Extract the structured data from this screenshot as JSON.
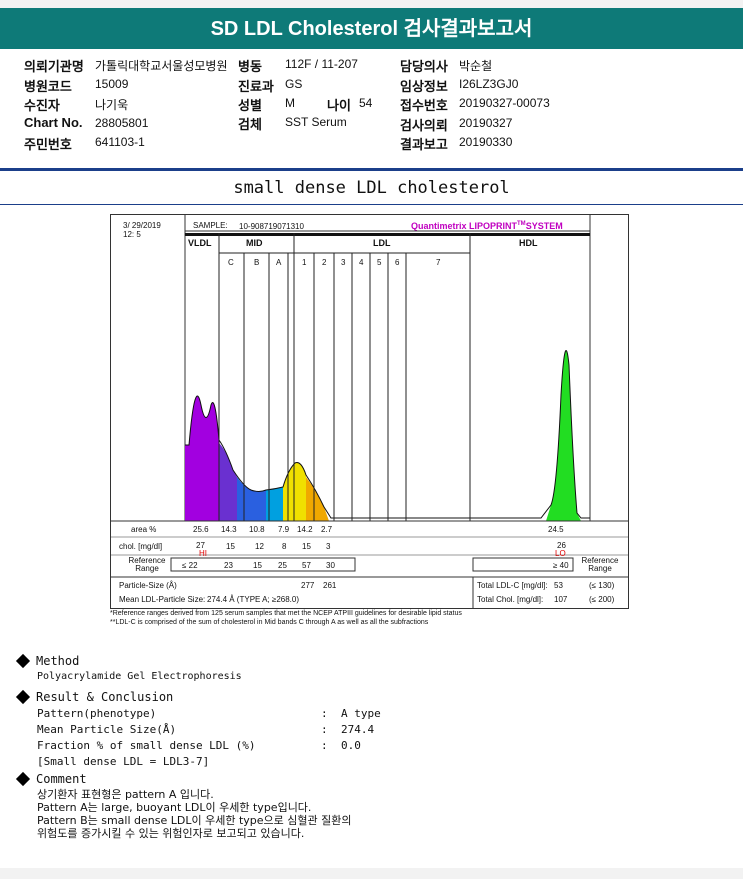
{
  "title": "SD LDL Cholesterol 검사결과보고서",
  "patient": {
    "hospital_label": "의뢰기관명",
    "hospital_value": "가톨릭대학교서울성모병원",
    "ward_label": "병동",
    "ward_value": "112F / 11-207",
    "doctor_label": "담당의사",
    "doctor_value": "박순철",
    "hcode_label": "병원코드",
    "hcode_value": "15009",
    "dept_label": "진료과",
    "dept_value": "GS",
    "clinical_label": "임상정보",
    "clinical_value": "I26LZ3GJ0",
    "name_label": "수진자",
    "name_value": "나기욱",
    "sex_label": "성별",
    "sex_value": "M",
    "age_label": "나이",
    "age_value": "54",
    "reg_label": "접수번호",
    "reg_value": "20190327-00073",
    "chart_label": "Chart No.",
    "chart_value": "28805801",
    "spec_label": "검체",
    "spec_value": "SST Serum",
    "req_label": "검사의뢰",
    "req_value": "20190327",
    "rrn_label": "주민번호",
    "rrn_value": "641103-1",
    "rep_label": "결과보고",
    "rep_value": "20190330"
  },
  "subtitle": "small dense LDL cholesterol",
  "chart": {
    "date": "3/ 29/2019",
    "time": "12: 5",
    "sample_label": "SAMPLE:",
    "sample_value": "10-908719071310",
    "brand": "Quantimetrix LIPOPRINT",
    "brand_tm": "TM",
    "brand_suffix": "SYSTEM",
    "group_vldl": "VLDL",
    "group_mid": "MID",
    "group_ldl": "LDL",
    "group_hdl": "HDL",
    "bands": [
      "C",
      "B",
      "A",
      "1",
      "2",
      "3",
      "4",
      "5",
      "6",
      "7"
    ],
    "row_area_label": "area %",
    "row_chol_label": "chol. [mg/dl]",
    "row_ref_label": "Reference Range",
    "ref_range_right": "Reference Range",
    "area_values": [
      "25.6",
      "14.3",
      "10.8",
      "7.9",
      "14.2",
      "2.7"
    ],
    "area_hdl": "24.5",
    "chol_values": [
      "27",
      "15",
      "12",
      "8",
      "15",
      "3"
    ],
    "chol_hdl": "26",
    "flag_hi": "HI",
    "flag_lo": "LO",
    "ref_values": [
      "≤ 22",
      "23",
      "15",
      "25",
      "57",
      "30"
    ],
    "ref_hdl": "≥ 40",
    "particle_label": "Particle-Size (Å)",
    "particle_values": [
      "277",
      "261"
    ],
    "mean_label": "Mean LDL-Particle Size:",
    "mean_value": "274.4 Å  (TYPE A; ≥268.0)",
    "total_ldl_label": "Total LDL-C [mg/dl]:",
    "total_ldl_value": "53",
    "total_ldl_ref": "(≤ 130)",
    "total_chol_label": "Total Chol. [mg/dl]:",
    "total_chol_value": "107",
    "total_chol_ref": "(≤ 200)"
  },
  "chart_data": {
    "type": "area",
    "x": [
      0,
      20,
      40,
      60,
      80,
      100
    ],
    "series": []
  },
  "notes": [
    "*Reference ranges derived from 125 serum samples that met the NCEP ATPIII guidelines for desirable lipid status",
    "**LDL-C is comprised of the sum of cholesterol in Mid bands C through A as well as all the subfractions"
  ],
  "method": {
    "heading": "Method",
    "text": "Polyacrylamide Gel Electrophoresis"
  },
  "result": {
    "heading": "Result & Conclusion",
    "rows": [
      {
        "label": "Pattern(phenotype)",
        "value": "A type"
      },
      {
        "label": "Mean Particle Size(Å)",
        "value": "274.4"
      },
      {
        "label": "Fraction % of small dense LDL (%)",
        "value": "0.0"
      }
    ],
    "note": "[Small dense LDL = LDL3-7]"
  },
  "comment": {
    "heading": "Comment",
    "lines": [
      "상기환자 표현형은 pattern A 입니다.",
      "Pattern A는 large, buoyant LDL이 우세한 type입니다.",
      "Pattern B는 small dense LDL이 우세한 type으로 심혈관 질환의",
      "위험도를 증가시킬 수 있는 위험인자로 보고되고 있습니다."
    ]
  }
}
